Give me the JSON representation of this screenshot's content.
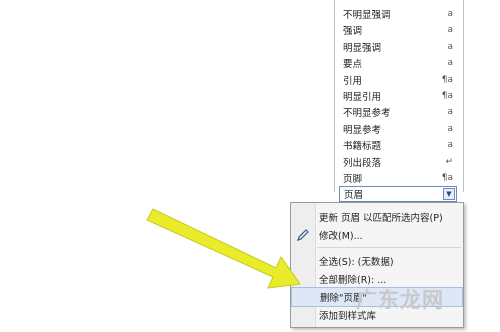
{
  "styles_panel": {
    "items": [
      {
        "name": "不明显强调",
        "glyph": "a"
      },
      {
        "name": "强调",
        "glyph": "a"
      },
      {
        "name": "明显强调",
        "glyph": "a"
      },
      {
        "name": "要点",
        "glyph": "a"
      },
      {
        "name": "引用",
        "glyph": "¶a"
      },
      {
        "name": "明显引用",
        "glyph": "¶a"
      },
      {
        "name": "不明显参考",
        "glyph": "a"
      },
      {
        "name": "明显参考",
        "glyph": "a"
      },
      {
        "name": "书籍标题",
        "glyph": "a"
      },
      {
        "name": "列出段落",
        "glyph": "↵"
      },
      {
        "name": "页脚",
        "glyph": "¶a"
      }
    ],
    "selected": {
      "name": "页眉",
      "dropdown": "▼"
    }
  },
  "context_menu": {
    "update": "更新 页眉 以匹配所选内容(P)",
    "modify": "修改(M)...",
    "select_all": "全选(S): (无数据)",
    "delete_all": "全部删除(R): ...",
    "delete": "删除\"页眉\"",
    "add_to_gallery": "添加到样式库"
  },
  "watermark": "广东龙网",
  "colors": {
    "arrow": "#e8ec2a",
    "arrow_outline": "#c9c91a",
    "highlight": "#dde7f5"
  }
}
